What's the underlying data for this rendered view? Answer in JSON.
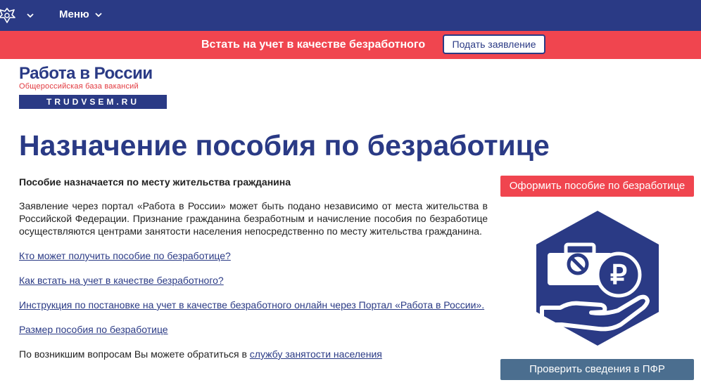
{
  "header": {
    "menu_label": "Меню",
    "emblem_icon": "eagle-emblem-icon",
    "color": "#2a3a85"
  },
  "banner": {
    "text": "Встать на учет в качестве безработного",
    "button_label": "Подать заявление",
    "color": "#f0454f"
  },
  "logo": {
    "title": "Работа в России",
    "subtitle": "Общероссийская база вакансий",
    "domain": "TRUDVSEM.RU"
  },
  "page": {
    "title": "Назначение пособия по безработице",
    "lead": "Пособие назначается по месту жительства гражданина",
    "paragraph": "Заявление через портал «Работа в России» может быть подано независимо от места жительства в Российской Федерации. Признание гражданина безработным и начисление пособия по безработице осуществляются центрами занятости населения непосредственно по месту жительства гражданина.",
    "links": [
      "Кто может получить пособие по безработице?",
      "Как встать на учет в качестве безработного?",
      "Инструкция по постановке на учет в качестве безработного онлайн через Портал «Работа в России».",
      "Размер пособия по безработице"
    ],
    "contact_prefix": "По возникшим вопросам Вы можете обратиться в ",
    "contact_link": "службу занятости населения"
  },
  "sidebar": {
    "apply_button": "Оформить пособие по безработице",
    "pfr_button": "Проверить сведения в ПФР",
    "illustration_icon": "hand-briefcase-ruble-icon",
    "apply_color": "#f0454f",
    "pfr_color": "#4b6e8f"
  }
}
